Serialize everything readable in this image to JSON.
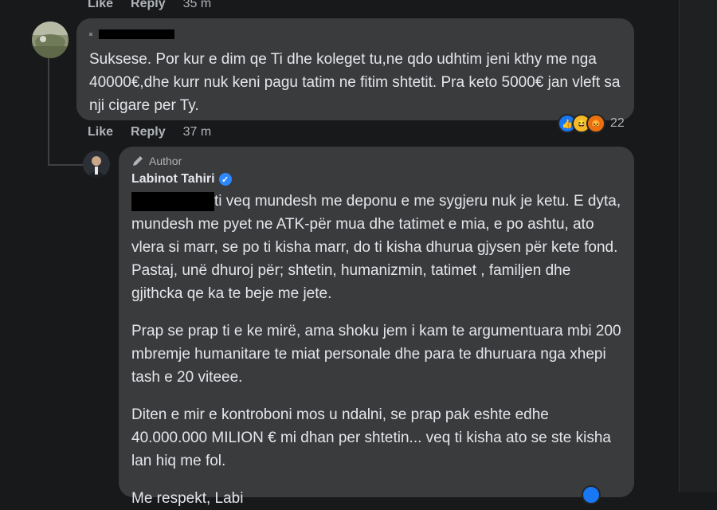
{
  "top_actions": {
    "like": "Like",
    "reply": "Reply",
    "time": "35 m"
  },
  "comment1": {
    "text": "Suksese. Por kur e dim qe Ti dhe koleget tu,ne qdo udhtim jeni kthy me nga 40000€,dhe kurr nuk keni pagu tatim ne fitim shtetit. Pra keto 5000€ jan vleft sa nji cigare per Ty.",
    "actions": {
      "like": "Like",
      "reply": "Reply",
      "time": "37 m"
    },
    "reaction_count": "22",
    "reaction_icons": [
      "like-icon",
      "haha-icon",
      "angry-icon"
    ]
  },
  "reply": {
    "badge": "Author",
    "author": "Labinot Tahiri",
    "paragraphs": [
      "ti veq mundesh me deponu e me sygjeru nuk je ketu. E dyta, mundesh me pyet ne ATK-për mua dhe tatimet e mia, e po ashtu, ato vlera si marr, se po ti kisha marr, do ti kisha dhurua gjysen për kete fond. Pastaj, unë dhuroj për; shtetin, humanizmin, tatimet , familjen dhe gjithcka qe ka te beje me jete.",
      "Prap se prap ti e ke mirë, ama shoku jem i kam te argumentuara mbi 200 mbremje humanitare te miat personale dhe para te dhuruara nga xhepi tash e 20 viteee.",
      "Diten e mir e kontroboni mos u ndalni, se prap pak eshte edhe 40.000.000 MILION € mi dhan per shtetin... veq ti kisha ato se ste kisha lan hiq me fol.",
      "Me respekt, Labi"
    ]
  },
  "colors": {
    "background": "#18191a",
    "bubble": "#3a3b3c",
    "text": "#e4e6eb",
    "muted": "#b0b3b8",
    "verified": "#2d88ff"
  }
}
